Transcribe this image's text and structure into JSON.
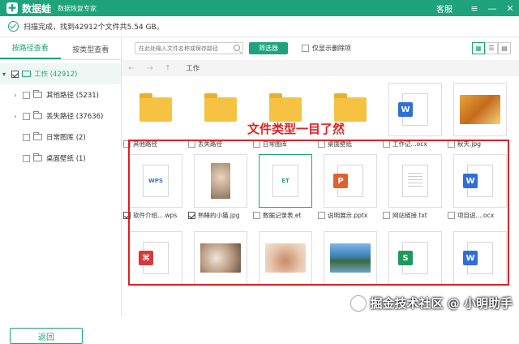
{
  "app": {
    "name": "数据蛙",
    "subtitle": "数据恢复专家",
    "support_label": "客服",
    "window_buttons": [
      "≡",
      "—",
      "✕"
    ]
  },
  "status": {
    "text": "扫描完成，找到42912个文件共5.54 GB。"
  },
  "left": {
    "tabs": [
      "按路径查看",
      "按类型查看"
    ],
    "active_tab": 0,
    "root": {
      "label": "工作 (42912)",
      "checked": true,
      "expanded": true
    },
    "items": [
      {
        "label": "其他路径 (5231)",
        "expandable": true
      },
      {
        "label": "丢失路径 (37636)",
        "expandable": true
      },
      {
        "label": "日常图库 (2)",
        "expandable": false
      },
      {
        "label": "桌面壁纸 (1)",
        "expandable": false
      }
    ],
    "back_label": "返回"
  },
  "toolbar": {
    "search_placeholder": "在此处输入文件名称或保存路径",
    "filter_label": "筛选器",
    "deleted_only_label": "仅显示删除项"
  },
  "nav": {
    "back": "←",
    "forward": "→",
    "up": "↑",
    "path": "工作"
  },
  "annotation": {
    "text": "文件类型一目了然"
  },
  "watermark": {
    "text": "掘金技术社区 @ 小明助手"
  },
  "files_row1": [
    {
      "name": "其他路径",
      "kind": "folder",
      "checked": false
    },
    {
      "name": "丢失路径",
      "kind": "folder",
      "checked": false
    },
    {
      "name": "日常图库",
      "kind": "folder",
      "checked": false
    },
    {
      "name": "桌面壁纸",
      "kind": "folder",
      "checked": false
    },
    {
      "name": "工作记...ocx",
      "kind": "word",
      "checked": false
    },
    {
      "name": "秋天.jpg",
      "kind": "photo-autumn",
      "checked": false
    }
  ],
  "files_row2": [
    {
      "name": "软件介绍....wps",
      "kind": "wps",
      "checked": true
    },
    {
      "name": "熟睡的小猫.jpg",
      "kind": "photo-cat",
      "checked": true
    },
    {
      "name": "数据记录表.et",
      "kind": "et",
      "checked": false
    },
    {
      "name": "说明展示.pptx",
      "kind": "ppt",
      "checked": false
    },
    {
      "name": "网站链接.txt",
      "kind": "txt",
      "checked": false
    },
    {
      "name": "项目说....ocx",
      "kind": "word",
      "checked": false
    }
  ],
  "files_row3": [
    {
      "kind": "pdf"
    },
    {
      "kind": "photo-kittens"
    },
    {
      "kind": "photo-rabbit"
    },
    {
      "kind": "photo-lake"
    },
    {
      "kind": "sheet"
    },
    {
      "kind": "word"
    }
  ],
  "colors": {
    "accent": "#1fa37c",
    "annotation": "#e02020",
    "word": "#2f6fd8",
    "ppt": "#e2612b",
    "pdf": "#d9393a",
    "sheet": "#1d9a5b"
  }
}
